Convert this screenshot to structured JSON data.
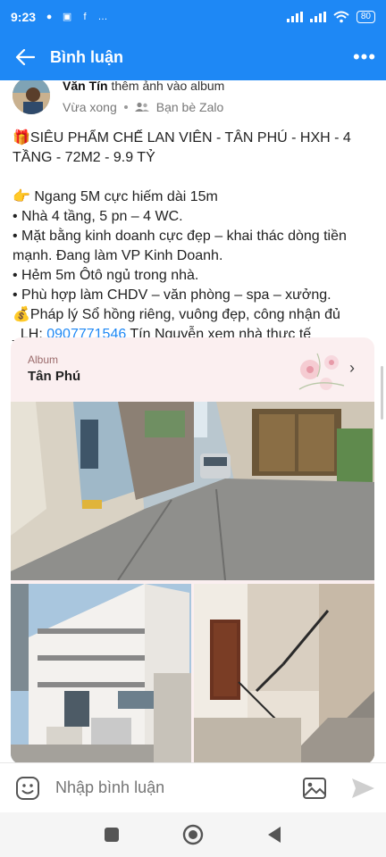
{
  "status_bar": {
    "time": "9:23",
    "battery": "80"
  },
  "header": {
    "title": "Bình luận"
  },
  "post": {
    "author": "Văn Tín",
    "action": " thêm ảnh vào album",
    "time": "Vừa xong",
    "audience": "Bạn bè Zalo",
    "lines": [
      "🎁SIÊU PHẨM CHẾ LAN VIÊN - TÂN PHÚ - HXH - 4 TẦNG - 72M2 - 9.9 TỶ",
      "👉 Ngang 5M cực hiếm dài 15m",
      "• Nhà 4 tầng, 5 pn – 4 WC.",
      "• Mặt bằng kinh doanh cực đẹp – khai thác dòng tiền mạnh. Đang làm VP Kinh Doanh.",
      "• Hẻm 5m Ôtô ngủ trong nhà.",
      "• Phù hợp làm CHDV – văn phòng – spa – xưởng.",
      "💰Pháp lý Sổ hồng riêng, vuông đẹp, công nhận đủ"
    ],
    "contact_prefix": "_LH: ",
    "phone": "0907771546",
    "contact_suffix": " Tín Nguyễn xem nhà thực tế"
  },
  "album": {
    "label": "Album",
    "name": "Tân Phú"
  },
  "comment": {
    "placeholder": "Nhập bình luận"
  },
  "colors": {
    "accent": "#1e88f5",
    "album_bg": "#fbeff0"
  }
}
